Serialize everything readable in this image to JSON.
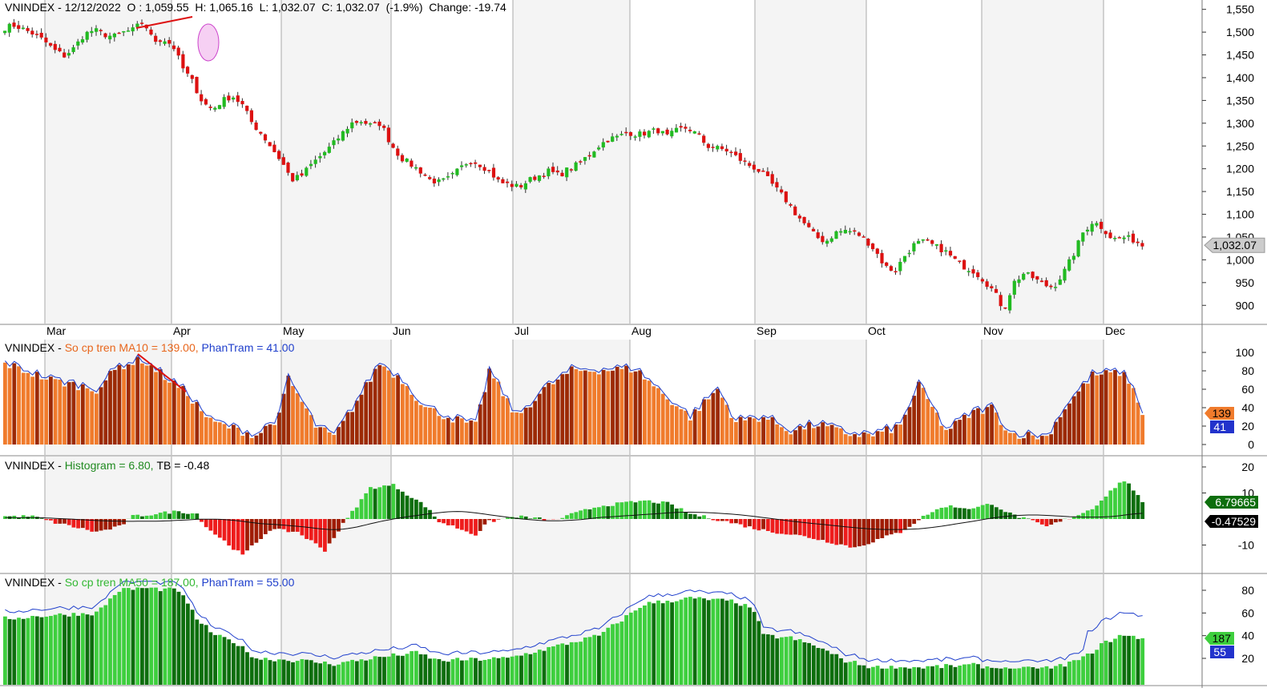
{
  "panes": {
    "price": {
      "title": {
        "symbol": "VNINDEX",
        "date": "12/12/2022",
        "open": "O : 1,059.55",
        "high": "H: 1,065.16",
        "low": "L: 1,032.07",
        "close": "C: 1,032.07",
        "pct": "(-1.9%)",
        "change": "Change: -19.74"
      },
      "last_label": "1,032.07"
    },
    "ma10": {
      "title": {
        "symbol": "VNINDEX",
        "ind": "So cp tren MA10 = 139.00,",
        "pct": "PhanTram = 41.00"
      },
      "label_count": "139",
      "label_pct": "41"
    },
    "hist": {
      "title": {
        "symbol": "VNINDEX",
        "ind": "Histogram = 6.80,",
        "tb": "TB = -0.48"
      },
      "label_hist": "6.79665",
      "label_tb": "-0.47529"
    },
    "ma50": {
      "title": {
        "symbol": "VNINDEX",
        "ind": "So cp tren MA50 = 187.00,",
        "pct": "PhanTram = 55.00"
      },
      "label_count": "187",
      "label_pct": "55"
    }
  },
  "colors": {
    "up": "#22bb22",
    "down": "#dd1111",
    "wick": "#333333",
    "orange": "#f07b2c",
    "darkred": "#9c2a05",
    "green_dark": "#0d6e0d",
    "green_light": "#3ecf3e",
    "red_bar": "#ee1c1c",
    "darkred_bar": "#a01c04",
    "blue_line": "#1f3fcc",
    "red_line": "#dd1111",
    "grid_bg": "#f4f4f4"
  },
  "chart_data": [
    {
      "type": "candlestick",
      "name": "VNINDEX",
      "x_months": [
        "Mar",
        "Apr",
        "May",
        "Jun",
        "Jul",
        "Aug",
        "Sep",
        "Oct",
        "Nov",
        "Dec"
      ],
      "y_ticks": [
        900,
        950,
        1000,
        1050,
        1100,
        1150,
        1200,
        1250,
        1300,
        1350,
        1400,
        1450,
        1500,
        1550
      ],
      "ylim": [
        860,
        1560
      ],
      "close_path": [
        1510,
        1515,
        1505,
        1495,
        1480,
        1460,
        1448,
        1465,
        1495,
        1505,
        1495,
        1490,
        1500,
        1505,
        1525,
        1480,
        1485,
        1470,
        1420,
        1390,
        1345,
        1330,
        1350,
        1360,
        1340,
        1300,
        1275,
        1245,
        1215,
        1175,
        1185,
        1210,
        1230,
        1250,
        1275,
        1300,
        1305,
        1295,
        1300,
        1255,
        1225,
        1210,
        1195,
        1175,
        1170,
        1180,
        1200,
        1220,
        1210,
        1195,
        1170,
        1165,
        1160,
        1175,
        1185,
        1195,
        1185,
        1200,
        1210,
        1230,
        1250,
        1265,
        1270,
        1280,
        1275,
        1280,
        1285,
        1270,
        1285,
        1290,
        1275,
        1250,
        1245,
        1240,
        1225,
        1210,
        1200,
        1180,
        1155,
        1130,
        1100,
        1075,
        1050,
        1040,
        1060,
        1065,
        1060,
        1045,
        1020,
        985,
        975,
        1010,
        1035,
        1040,
        1030,
        1020,
        1000,
        985,
        975,
        955,
        930,
        890,
        950,
        970,
        960,
        945,
        940,
        970,
        1010,
        1060,
        1085,
        1070,
        1045,
        1050,
        1045,
        1032
      ]
    },
    {
      "type": "bar",
      "name": "So cp tren MA10",
      "y_ticks": [
        0,
        20,
        40,
        60,
        80,
        100
      ],
      "ylim": [
        0,
        100
      ],
      "series_hint": "PhanTram line (blue) over orange/dark-red bars"
    },
    {
      "type": "bar",
      "name": "Histogram",
      "y_ticks": [
        -10,
        0,
        10,
        20
      ],
      "ylim": [
        -16,
        22
      ],
      "series_hint": "green/red histogram with TB line"
    },
    {
      "type": "bar",
      "name": "So cp tren MA50",
      "y_ticks": [
        20,
        40,
        60,
        80
      ],
      "ylim": [
        10,
        88
      ],
      "series_hint": "green bars with PhanTram line (blue)"
    }
  ]
}
